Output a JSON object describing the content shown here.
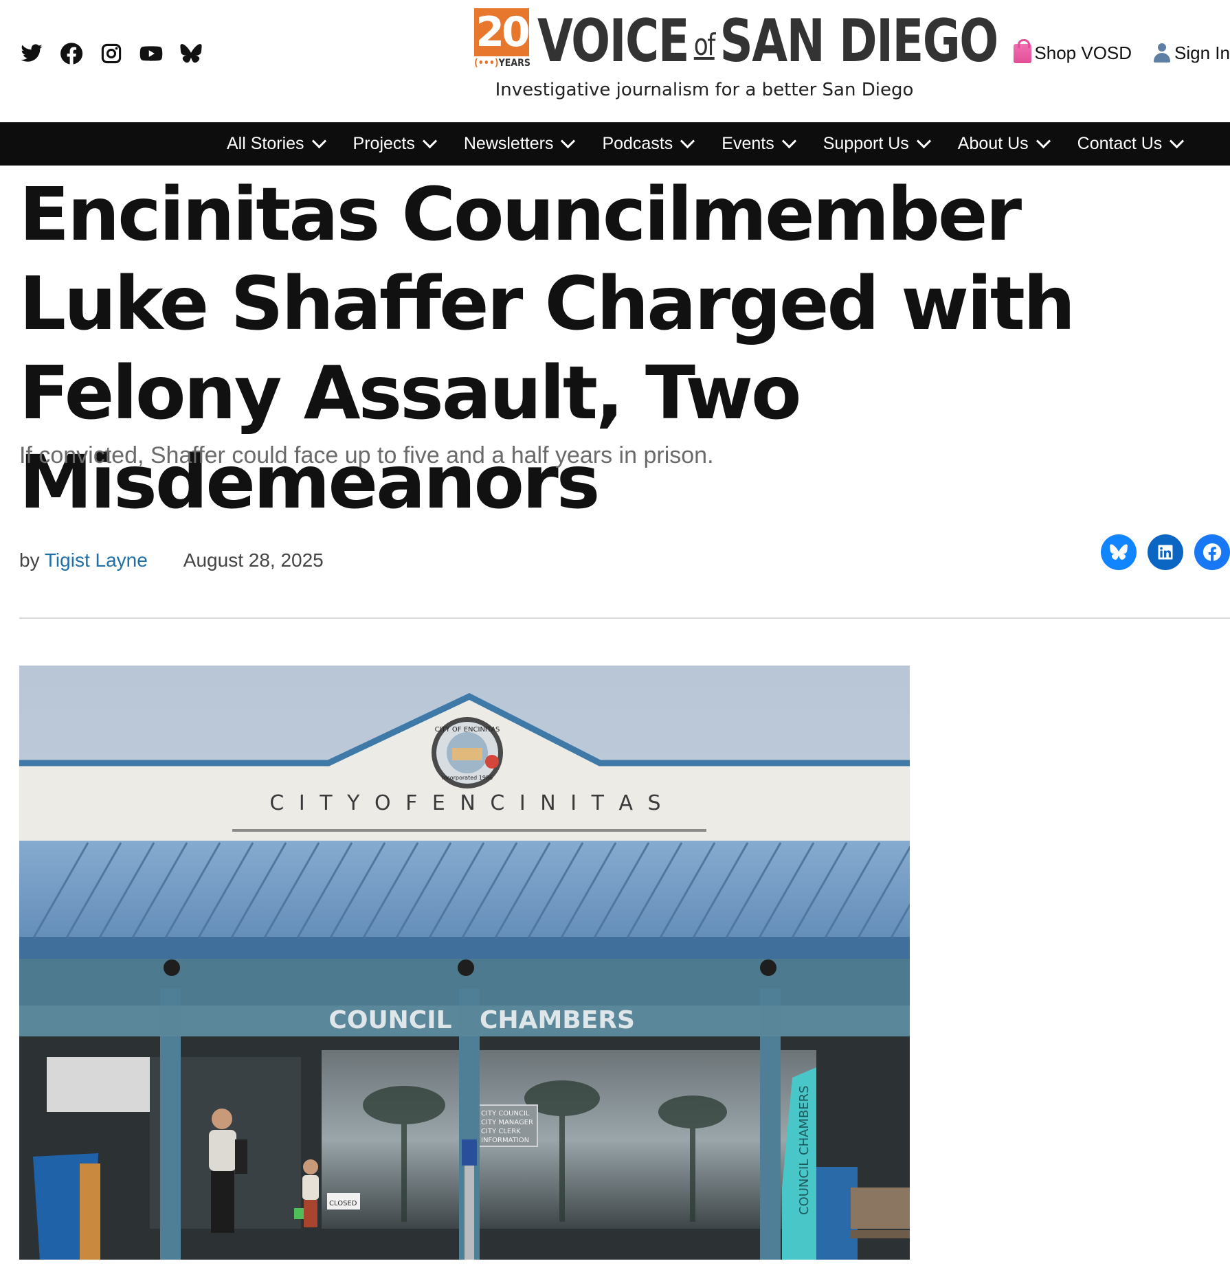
{
  "header": {
    "social_icons": [
      "twitter-icon",
      "facebook-icon",
      "instagram-icon",
      "youtube-icon",
      "bluesky-icon"
    ],
    "logo": {
      "badge_number": "20",
      "badge_text": "YEARS",
      "brand_left": "VOICE",
      "brand_of": "of",
      "brand_right": "SAN DIEGO"
    },
    "tagline": "Investigative journalism for a better San Diego",
    "shop_label": "Shop VOSD",
    "signin_label": "Sign In"
  },
  "nav": {
    "items": [
      {
        "label": "All Stories"
      },
      {
        "label": "Projects"
      },
      {
        "label": "Newsletters"
      },
      {
        "label": "Podcasts"
      },
      {
        "label": "Events"
      },
      {
        "label": "Support Us"
      },
      {
        "label": "About Us"
      },
      {
        "label": "Contact Us"
      }
    ]
  },
  "article": {
    "headline": "Encinitas Councilmember Luke Shaffer Charged with Felony Assault, Two Misdemeanors",
    "dek": "If convicted, Shaffer could face up to five and a half years in prison.",
    "byline_prefix": "by",
    "author": "Tigist Layne",
    "date": "August 28, 2025",
    "share_icons": [
      "bluesky-icon",
      "linkedin-icon",
      "facebook-icon"
    ]
  },
  "photo": {
    "facade_text": "C I T Y   O F   E N C I N I T A S",
    "sign_left": "COUNCIL",
    "sign_right": "CHAMBERS",
    "pillar_sign": "COUNCIL CHAMBERS",
    "seal_top": "CITY OF ENCINITAS",
    "seal_bottom": "Incorporated 1986",
    "window_sign": [
      "CITY COUNCIL",
      "CITY MANAGER",
      "CITY CLERK",
      "INFORMATION"
    ],
    "door_sign": "CLOSED"
  },
  "colors": {
    "nav_bg": "#0d0d0d",
    "accent_orange": "#e8772e",
    "link_blue": "#1f6fa8",
    "bluesky": "#1185fe",
    "linkedin": "#0a66c2",
    "facebook": "#1877f2",
    "roof_blue": "#6f98c2",
    "trim_teal": "#4f7f96"
  }
}
